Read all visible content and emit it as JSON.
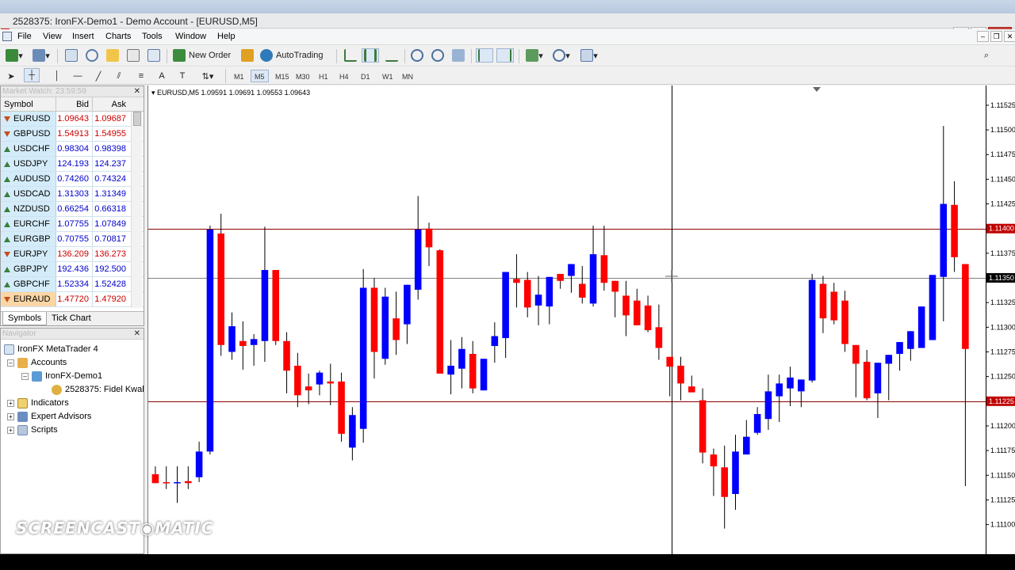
{
  "window": {
    "title": "2528375: IronFX-Demo1 - Demo Account - [EURUSD,M5]",
    "icon_name": "metatrader-app-icon"
  },
  "menu": {
    "items": [
      "File",
      "View",
      "Insert",
      "Charts",
      "Tools",
      "Window",
      "Help"
    ]
  },
  "toolbar": {
    "new_order": "New Order",
    "autotrading": "AutoTrading"
  },
  "timeframes": {
    "items": [
      "M1",
      "M5",
      "M15",
      "M30",
      "H1",
      "H4",
      "D1",
      "W1",
      "MN"
    ],
    "active": "M5"
  },
  "market_watch": {
    "title": "Market Watch: 23:59:59",
    "headers": {
      "symbol": "Symbol",
      "bid": "Bid",
      "ask": "Ask"
    },
    "rows": [
      {
        "symbol": "EURUSD",
        "bid": "1.09643",
        "ask": "1.09687",
        "dir": "down"
      },
      {
        "symbol": "GBPUSD",
        "bid": "1.54913",
        "ask": "1.54955",
        "dir": "down"
      },
      {
        "symbol": "USDCHF",
        "bid": "0.98304",
        "ask": "0.98398",
        "dir": "up"
      },
      {
        "symbol": "USDJPY",
        "bid": "124.193",
        "ask": "124.237",
        "dir": "up"
      },
      {
        "symbol": "AUDUSD",
        "bid": "0.74260",
        "ask": "0.74324",
        "dir": "up"
      },
      {
        "symbol": "USDCAD",
        "bid": "1.31303",
        "ask": "1.31349",
        "dir": "up"
      },
      {
        "symbol": "NZDUSD",
        "bid": "0.66254",
        "ask": "0.66318",
        "dir": "up"
      },
      {
        "symbol": "EURCHF",
        "bid": "1.07755",
        "ask": "1.07849",
        "dir": "up"
      },
      {
        "symbol": "EURGBP",
        "bid": "0.70755",
        "ask": "0.70817",
        "dir": "up"
      },
      {
        "symbol": "EURJPY",
        "bid": "136.209",
        "ask": "136.273",
        "dir": "down"
      },
      {
        "symbol": "GBPJPY",
        "bid": "192.436",
        "ask": "192.500",
        "dir": "up"
      },
      {
        "symbol": "GBPCHF",
        "bid": "1.52334",
        "ask": "1.52428",
        "dir": "up"
      },
      {
        "symbol": "EURAUD",
        "bid": "1.47720",
        "ask": "1.47920",
        "dir": "down"
      }
    ],
    "tabs": [
      "Symbols",
      "Tick Chart"
    ]
  },
  "navigator": {
    "title": "Navigator",
    "root": "IronFX MetaTrader 4",
    "accounts": "Accounts",
    "server": "IronFX-Demo1",
    "account": "2528375: Fidel Kwal",
    "indicators": "Indicators",
    "experts": "Expert Advisors",
    "scripts": "Scripts"
  },
  "chart": {
    "label": "EURUSD,M5  1.09591 1.09691 1.09553 1.09643",
    "price_labels": [
      "1.11525",
      "1.11500",
      "1.11475",
      "1.11450",
      "1.11425",
      "1.11400",
      "1.11375",
      "1.11350",
      "1.11325",
      "1.11300",
      "1.11275",
      "1.11250",
      "1.11225",
      "1.11200",
      "1.11175",
      "1.11150",
      "1.11125",
      "1.11100"
    ],
    "hline_labels": [
      "1.11400",
      "1.11350",
      "1.11225"
    ],
    "colors": {
      "bull": "#0000ff",
      "bear": "#ff0000",
      "hline": "#8b0000",
      "current": "#808080"
    }
  },
  "chart_data": {
    "type": "candlestick",
    "symbol": "EURUSD",
    "timeframe": "M5",
    "ylim": [
      1.1107,
      1.11545
    ],
    "horizontal_lines": [
      1.114,
      1.1135,
      1.11225
    ],
    "ohlc": [
      [
        1.11151,
        1.11159,
        1.11145,
        1.11142
      ],
      [
        1.11143,
        1.11159,
        1.11136,
        1.11142
      ],
      [
        1.11142,
        1.11159,
        1.11122,
        1.11143
      ],
      [
        1.11144,
        1.11159,
        1.11136,
        1.11142
      ],
      [
        1.11148,
        1.11184,
        1.11143,
        1.11174
      ],
      [
        1.11174,
        1.11403,
        1.11171,
        1.11399
      ],
      [
        1.11395,
        1.11415,
        1.11271,
        1.11282
      ],
      [
        1.11275,
        1.11315,
        1.11267,
        1.11301
      ],
      [
        1.11286,
        1.11306,
        1.11257,
        1.11281
      ],
      [
        1.11282,
        1.11293,
        1.11261,
        1.11288
      ],
      [
        1.11286,
        1.11402,
        1.11265,
        1.11358
      ],
      [
        1.11358,
        1.1135,
        1.11282,
        1.11286
      ],
      [
        1.11286,
        1.11295,
        1.11233,
        1.11256
      ],
      [
        1.11261,
        1.11274,
        1.11219,
        1.11231
      ],
      [
        1.1124,
        1.11253,
        1.11222,
        1.11236
      ],
      [
        1.11242,
        1.11256,
        1.11231,
        1.11254
      ],
      [
        1.11245,
        1.11263,
        1.11221,
        1.11243
      ],
      [
        1.11245,
        1.11254,
        1.11184,
        1.11192
      ],
      [
        1.11178,
        1.11219,
        1.11165,
        1.11211
      ],
      [
        1.11197,
        1.11359,
        1.11183,
        1.1134
      ],
      [
        1.1134,
        1.1135,
        1.11248,
        1.11275
      ],
      [
        1.11268,
        1.1134,
        1.11262,
        1.11331
      ],
      [
        1.11309,
        1.11336,
        1.11272,
        1.11287
      ],
      [
        1.11303,
        1.1133,
        1.11283,
        1.11343
      ],
      [
        1.11338,
        1.11433,
        1.11328,
        1.11399
      ],
      [
        1.114,
        1.11406,
        1.11362,
        1.11381
      ],
      [
        1.11378,
        1.11379,
        1.11255,
        1.11253
      ],
      [
        1.11252,
        1.11287,
        1.11232,
        1.11261
      ],
      [
        1.11258,
        1.1129,
        1.11238,
        1.11278
      ],
      [
        1.11273,
        1.11286,
        1.11233,
        1.11238
      ],
      [
        1.11236,
        1.11263,
        1.11243,
        1.11268
      ],
      [
        1.11281,
        1.11305,
        1.11264,
        1.11291
      ],
      [
        1.11289,
        1.11334,
        1.11269,
        1.11356
      ],
      [
        1.11349,
        1.11374,
        1.1132,
        1.11345
      ],
      [
        1.11348,
        1.11356,
        1.1131,
        1.1132
      ],
      [
        1.11322,
        1.11352,
        1.11302,
        1.11333
      ],
      [
        1.11321,
        1.11343,
        1.11303,
        1.11351
      ],
      [
        1.11354,
        1.11353,
        1.11339,
        1.11347
      ],
      [
        1.11352,
        1.11362,
        1.11335,
        1.11364
      ],
      [
        1.11344,
        1.11362,
        1.11324,
        1.1133
      ],
      [
        1.11324,
        1.11403,
        1.11321,
        1.11374
      ],
      [
        1.11373,
        1.11403,
        1.11337,
        1.11345
      ],
      [
        1.11347,
        1.11342,
        1.1131,
        1.11336
      ],
      [
        1.11332,
        1.11347,
        1.11291,
        1.11312
      ],
      [
        1.11327,
        1.11339,
        1.11304,
        1.11302
      ],
      [
        1.11322,
        1.11332,
        1.11295,
        1.11297
      ],
      [
        1.113,
        1.11323,
        1.11267,
        1.11279
      ],
      [
        1.1127,
        1.11265,
        1.1123,
        1.1126
      ],
      [
        1.11261,
        1.1127,
        1.11226,
        1.11243
      ],
      [
        1.1124,
        1.11251,
        1.11237,
        1.11234
      ],
      [
        1.11226,
        1.11238,
        1.11162,
        1.11173
      ],
      [
        1.11171,
        1.11177,
        1.11129,
        1.11159
      ],
      [
        1.11158,
        1.1118,
        1.11096,
        1.11128
      ],
      [
        1.11131,
        1.11191,
        1.11115,
        1.11174
      ],
      [
        1.11171,
        1.11206,
        1.11175,
        1.11189
      ],
      [
        1.11193,
        1.11219,
        1.11191,
        1.11212
      ],
      [
        1.11207,
        1.11252,
        1.11196,
        1.11235
      ],
      [
        1.1123,
        1.11252,
        1.11204,
        1.11243
      ],
      [
        1.11238,
        1.1126,
        1.1122,
        1.11249
      ],
      [
        1.11235,
        1.11227,
        1.11219,
        1.11247
      ],
      [
        1.11246,
        1.11354,
        1.11244,
        1.11348
      ],
      [
        1.11344,
        1.11352,
        1.11294,
        1.11309
      ],
      [
        1.11336,
        1.11345,
        1.11303,
        1.11307
      ],
      [
        1.11327,
        1.11337,
        1.11275,
        1.11283
      ],
      [
        1.11282,
        1.11263,
        1.11229,
        1.11263
      ],
      [
        1.11265,
        1.11277,
        1.11226,
        1.11228
      ],
      [
        1.11233,
        1.11263,
        1.11208,
        1.11264
      ],
      [
        1.11263,
        1.1127,
        1.11226,
        1.11272
      ],
      [
        1.11273,
        1.11272,
        1.11256,
        1.11285
      ],
      [
        1.11278,
        1.11283,
        1.11266,
        1.11296
      ],
      [
        1.11279,
        1.11317,
        1.11291,
        1.11321
      ],
      [
        1.11287,
        1.11321,
        1.11294,
        1.11353
      ],
      [
        1.11351,
        1.11504,
        1.11306,
        1.11425
      ],
      [
        1.11424,
        1.11448,
        1.11356,
        1.11371
      ],
      [
        1.11364,
        1.11352,
        1.11139,
        1.11278
      ]
    ]
  }
}
